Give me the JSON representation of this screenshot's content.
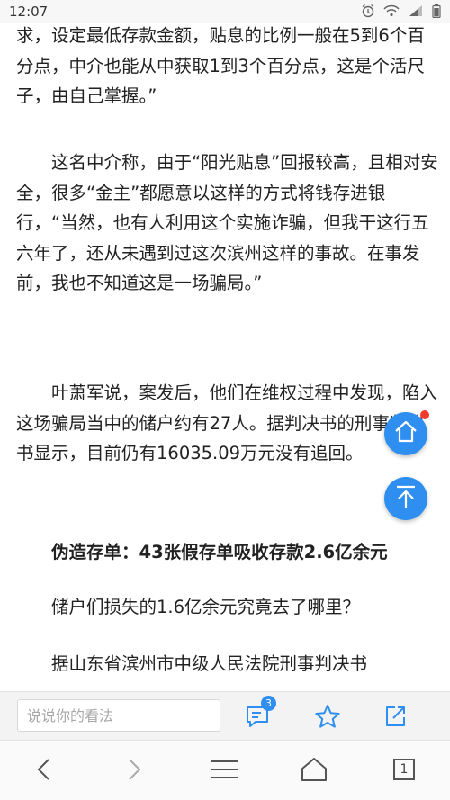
{
  "status_bar": {
    "time": "12:07",
    "icons": [
      "alarm-icon",
      "wifi-icon",
      "signal-icon",
      "battery-icon"
    ]
  },
  "article": {
    "paragraphs": [
      "求，设定最低存款金额，贴息的比例一般在5到6个百分点，中介也能从中获取1到3个百分点，这是个活尺子，由自己掌握。”",
      "这名中介称，由于“阳光贴息”回报较高，且相对安全，很多“金主”都愿意以这样的方式将钱存进银行，“当然，也有人利用这个实施诈骗，但我干这行五六年了，还从未遇到过这次滨州这样的事故。在事发前，我也不知道这是一场骗局。”",
      "叶萧军说，案发后，他们在维权过程中发现，陷入这场骗局当中的储户约有27人。据判决书的刑事判决书显示，目前仍有16035.09万元没有追回。",
      "伪造存单：43张假存单吸收存款2.6亿余元",
      "储户们损失的1.6亿余元究竟去了哪里？",
      "据山东省滨州市中级人民法院刑事判决书"
    ]
  },
  "floating": {
    "home_icon": "home-icon",
    "top_icon": "arrow-up-icon"
  },
  "comment_bar": {
    "placeholder": "说说你的看法",
    "comment_count": "3"
  },
  "nav": {
    "tab_count": "1"
  },
  "colors": {
    "accent": "#2f8ff0",
    "notification_dot": "#f23a2e",
    "text": "#222222"
  }
}
